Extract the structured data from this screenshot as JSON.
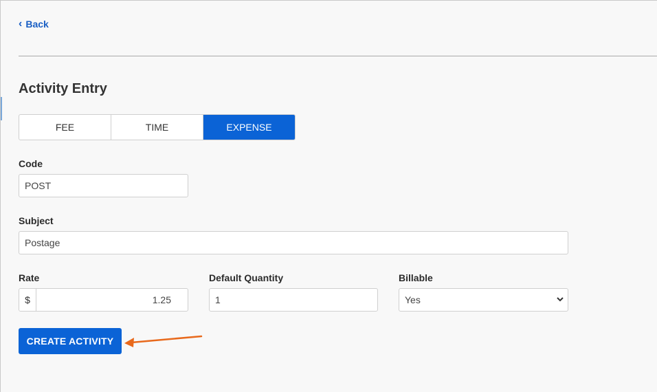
{
  "nav": {
    "back_label": "Back"
  },
  "page": {
    "title": "Activity Entry"
  },
  "tabs": [
    {
      "label": "FEE",
      "active": false
    },
    {
      "label": "TIME",
      "active": false
    },
    {
      "label": "EXPENSE",
      "active": true
    }
  ],
  "form": {
    "code": {
      "label": "Code",
      "value": "POST"
    },
    "subject": {
      "label": "Subject",
      "value": "Postage"
    },
    "rate": {
      "label": "Rate",
      "prefix": "$",
      "value": "1.25"
    },
    "default_quantity": {
      "label": "Default Quantity",
      "value": "1"
    },
    "billable": {
      "label": "Billable",
      "value": "Yes"
    }
  },
  "actions": {
    "create_label": "CREATE ACTIVITY"
  },
  "colors": {
    "primary": "#0b63d6",
    "link": "#1a5fc4",
    "annotation_arrow": "#e8691c"
  },
  "icons": {
    "back": "chevron-left-icon",
    "select": "chevron-down-icon",
    "annotation": "arrow-annotation"
  }
}
